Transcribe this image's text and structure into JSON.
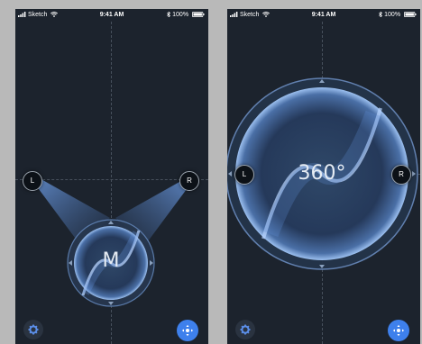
{
  "screens": [
    {
      "status": {
        "carrier": "Sketch",
        "time": "9:41 AM",
        "battery": "100%"
      },
      "speaker_left": "L",
      "speaker_right": "R",
      "mode_label": "M"
    },
    {
      "status": {
        "carrier": "Sketch",
        "time": "9:41 AM",
        "battery": "100%"
      },
      "speaker_left": "L",
      "speaker_right": "R",
      "mode_label": "360°"
    }
  ],
  "icons": {
    "settings": "gear-icon",
    "position": "move-position-icon",
    "wifi": "wifi-icon",
    "bluetooth": "bluetooth-icon",
    "battery": "battery-icon",
    "signal": "signal-icon"
  },
  "colors": {
    "background": "#1c232d",
    "accent": "#3e80ec",
    "glow": "#6f9fe8"
  }
}
